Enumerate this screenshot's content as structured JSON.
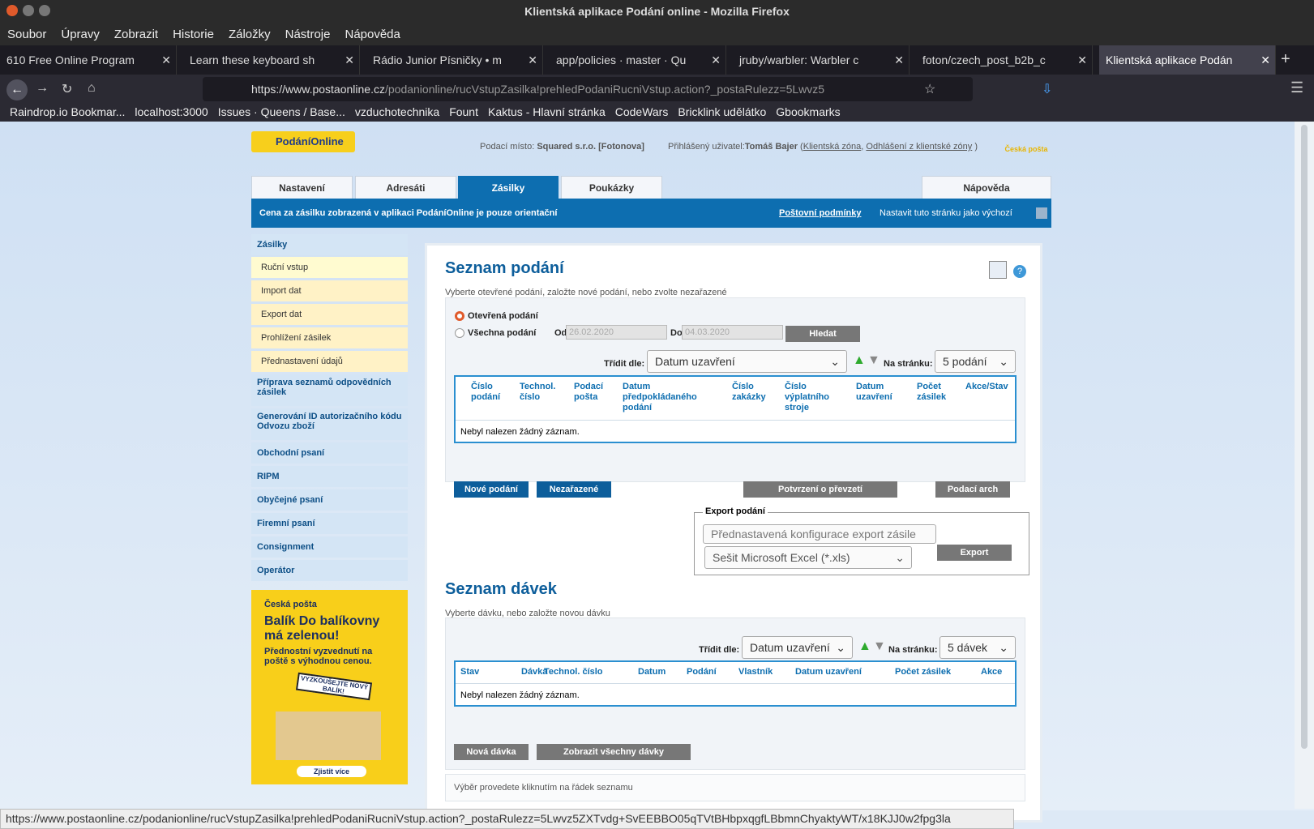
{
  "window_title": "Klientská aplikace Podání online - Mozilla Firefox",
  "menu": [
    "Soubor",
    "Úpravy",
    "Zobrazit",
    "Historie",
    "Záložky",
    "Nástroje",
    "Nápověda"
  ],
  "tabs": [
    "610 Free Online Program",
    "Learn these keyboard sh",
    "Rádio Junior Písničky • m",
    "app/policies · master · Qu",
    "jruby/warbler: Warbler c",
    "foton/czech_post_b2b_c",
    "Klientská aplikace Podán"
  ],
  "url_host": "https://www.postaonline.cz",
  "url_path": "/podanionline/rucVstupZasilka!prehledPodaniRucniVstup.action?_postaRulezz=5Lwvz5",
  "bookmarks": [
    "Raindrop.io Bookmar...",
    "localhost:3000",
    "Issues · Queens / Base...",
    "vzduchotechnika",
    "Fount",
    "Kaktus - Hlavní stránka",
    "CodeWars",
    "Bricklink udělátko",
    "Gbookmarks"
  ],
  "logo": "PodáníOnline",
  "podaci_misto_label": "Podací místo:",
  "podaci_misto": "Squared s.r.o. [Fotonova]",
  "user_label": "Přihlášený uživatel:",
  "user": "Tomáš Bajer",
  "klient_zona": "Klientská zóna",
  "odhlaseni": "Odhlášení z klientské zóny",
  "cp_logo": "Česká pošta",
  "main_tabs": [
    "Nastavení",
    "Adresáti",
    "Zásilky",
    "Poukázky"
  ],
  "help_tab": "Nápověda",
  "banner_text": "Cena za zásilku zobrazená v aplikaci PodáníOnline je pouze orientační",
  "postovni_podminky": "Poštovní podmínky",
  "nastavit": "Nastavit tuto stránku jako výchozí",
  "side_head": "Zásilky",
  "side_sub": [
    "Ruční vstup",
    "Import dat",
    "Export dat",
    "Prohlížení zásilek",
    "Přednastavení údajů"
  ],
  "side_items": [
    "Příprava seznamů odpovědních zásilek",
    "Generování ID autorizačního kódu Odvozu zboží",
    "Obchodní psaní",
    "RIPM",
    "Obyčejné psaní",
    "Firemní psaní",
    "Consignment",
    "Operátor"
  ],
  "ad": {
    "brand": "Česká pošta",
    "head": "Balík Do balíkovny má zelenou!",
    "text": "Přednostní vyzvednutí na poště s výhodnou cenou.",
    "stamp": "VYZKOUŠEJTE NOVÝ BALÍK!",
    "btn": "Zjistit více"
  },
  "seznam_podani": "Seznam podání",
  "seznam_podani_hint": "Vyberte otevřené podání, založte nové podání, nebo zvolte nezařazené",
  "radio_open": "Otevřená podání",
  "radio_all": "Všechna podání",
  "od": "Od",
  "do": "Do",
  "date_from": "26.02.2020",
  "date_to": "04.03.2020",
  "hledat": "Hledat",
  "sort_label": "Třídit dle:",
  "sort_value": "Datum uzavření",
  "per_page_label": "Na stránku:",
  "per_page_podani": "5 podání",
  "cols_podani": [
    "Číslo podání",
    "Technol. číslo",
    "Podací pošta",
    "Datum předpokládaného podání",
    "Číslo zakázky",
    "Číslo výplatního stroje",
    "Datum uzavření",
    "Počet zásilek",
    "Akce/Stav"
  ],
  "no_record": "Nebyl nalezen žádný záznam.",
  "btn_nove": "Nové podání",
  "btn_nezarazene": "Nezařazené",
  "btn_potvrzeni": "Potvrzení o převzetí",
  "btn_arch": "Podací arch",
  "export_legend": "Export podání",
  "export_config": "Přednastavená konfigurace export zásile",
  "export_format": "Sešit Microsoft Excel (*.xls)",
  "btn_export": "Export",
  "seznam_davek": "Seznam dávek",
  "seznam_davek_hint": "Vyberte dávku, nebo založte novou dávku",
  "per_page_davky": "5 dávek",
  "cols_davky": [
    "Stav",
    "Dávka",
    "Technol. číslo",
    "Datum",
    "Podání",
    "Vlastník",
    "Datum uzavření",
    "Počet zásilek",
    "Akce"
  ],
  "btn_nova_davka": "Nová dávka",
  "btn_vsechny": "Zobrazit všechny dávky",
  "vyber_hint": "Výběr provedete kliknutím na řádek seznamu",
  "status_url": "https://www.postaonline.cz/podanionline/rucVstupZasilka!prehledPodaniRucniVstup.action?_postaRulezz=5Lwvz5ZXTvdg+SvEEBBO05qTVtBHbpxqgfLBbmnChyaktyWT/x18KJJ0w2fpg3la"
}
